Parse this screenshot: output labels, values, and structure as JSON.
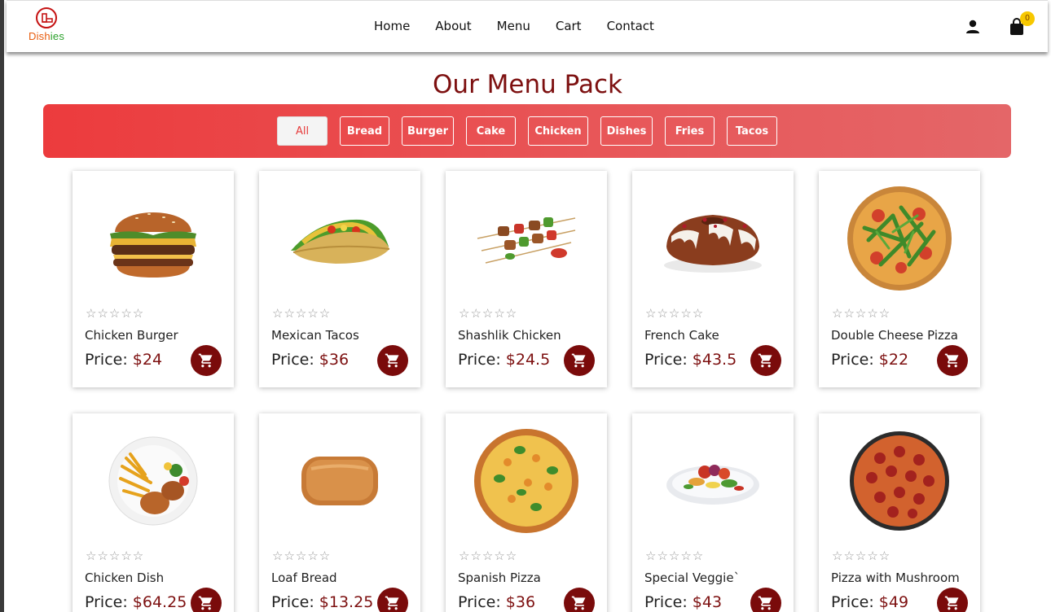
{
  "brand": {
    "logo_part1": "Dish",
    "logo_part2": "ies"
  },
  "nav": [
    "Home",
    "About",
    "Menu",
    "Cart",
    "Contact"
  ],
  "cart_count": "0",
  "page_title": "Our Menu Pack",
  "filters": [
    "All",
    "Bread",
    "Burger",
    "Cake",
    "Chicken",
    "Dishes",
    "Fries",
    "Tacos"
  ],
  "active_filter": "All",
  "price_prefix": "Price: ",
  "rating_stars": "☆☆☆☆☆",
  "products": [
    {
      "name": "Chicken Burger",
      "price": "$24",
      "image": "burger"
    },
    {
      "name": "Mexican Tacos",
      "price": "$36",
      "image": "tacos"
    },
    {
      "name": "Shashlik Chicken",
      "price": "$24.5",
      "image": "skewers"
    },
    {
      "name": "French Cake",
      "price": "$43.5",
      "image": "cake"
    },
    {
      "name": "Double Cheese Pizza",
      "price": "$22",
      "image": "pizza-arugula"
    },
    {
      "name": "Chicken Dish",
      "price": "$64.25",
      "image": "chicken-dish"
    },
    {
      "name": "Loaf Bread",
      "price": "$13.25",
      "image": "bread"
    },
    {
      "name": "Spanish Pizza",
      "price": "$36",
      "image": "pizza-basil"
    },
    {
      "name": "Special Veggie`",
      "price": "$43",
      "image": "veggie-plate"
    },
    {
      "name": "Pizza with Mushroom",
      "price": "$49",
      "image": "pizza-pepperoni"
    }
  ],
  "colors": {
    "accent": "#7d1010",
    "filter_bar": "#ec3b3d",
    "badge": "#f7c800"
  }
}
